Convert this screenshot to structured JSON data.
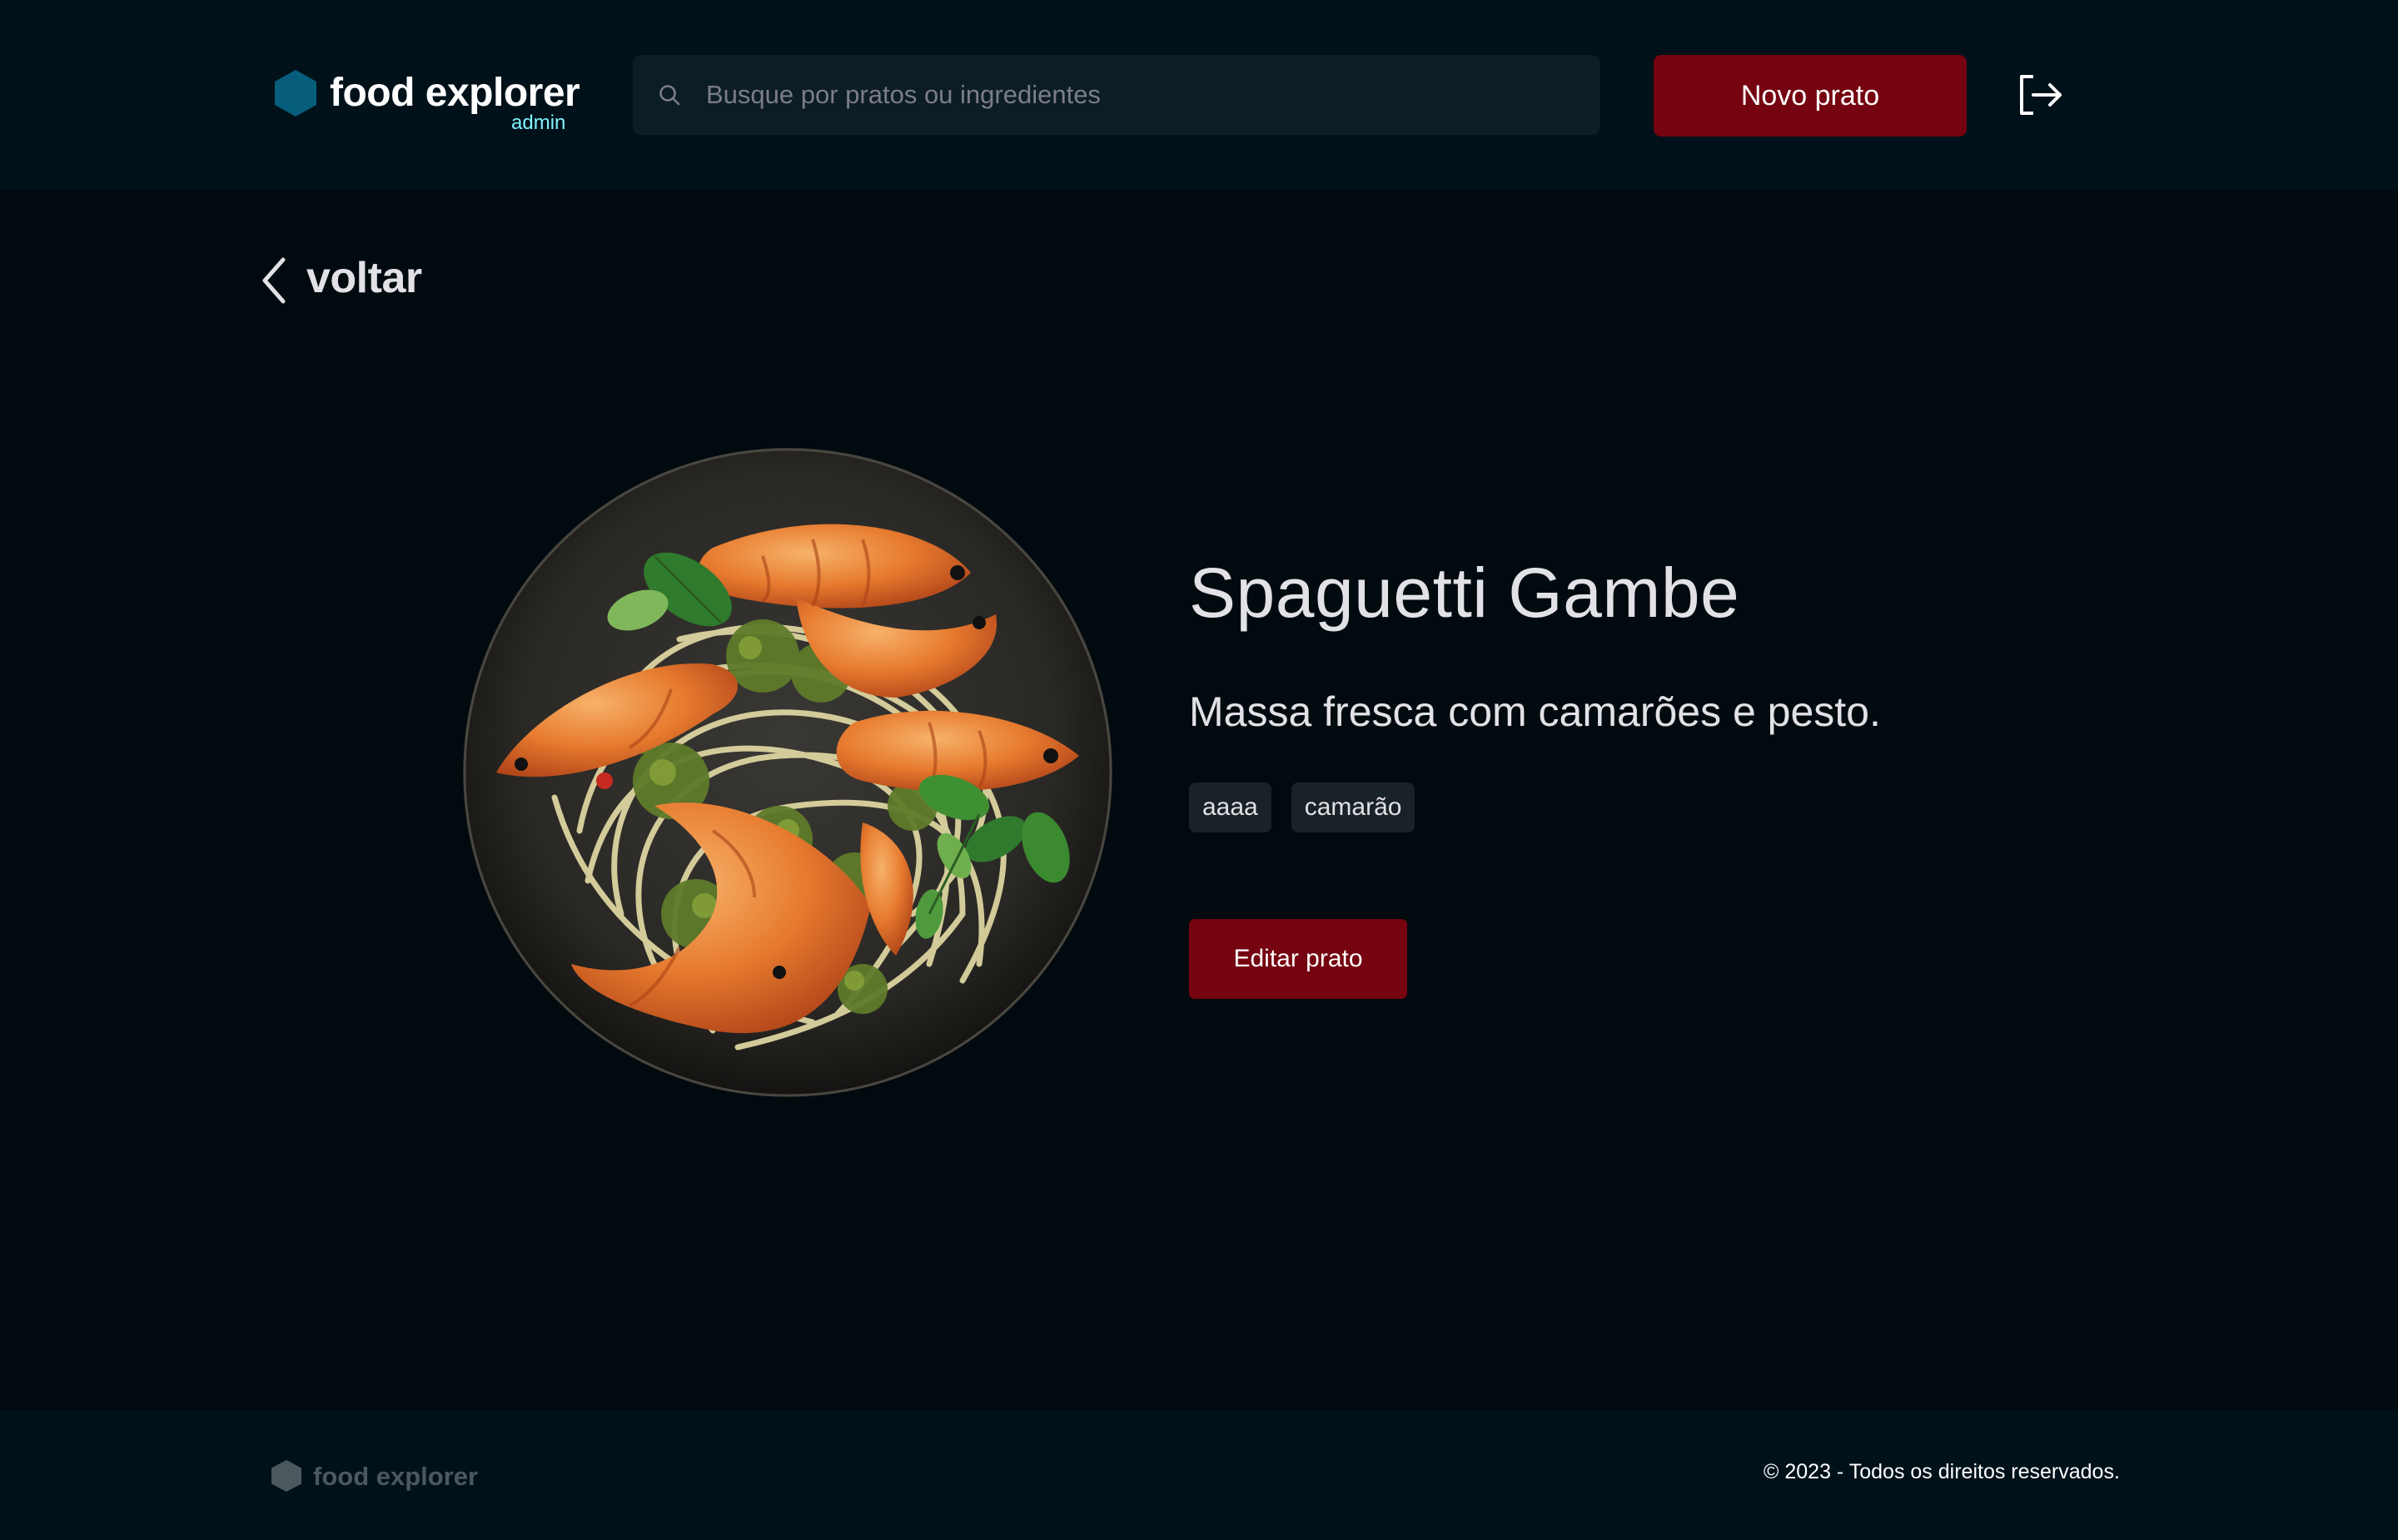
{
  "header": {
    "brand_name": "food explorer",
    "brand_badge": "admin",
    "brand_icon": "hexagon-logo-icon",
    "search": {
      "placeholder": "Busque por pratos ou ingredientes",
      "value": "",
      "icon": "search-icon"
    },
    "new_dish_label": "Novo prato",
    "logout_icon": "sign-out-icon"
  },
  "back": {
    "label": "voltar",
    "icon": "chevron-left-icon"
  },
  "dish": {
    "title": "Spaguetti Gambe",
    "description": "Massa fresca com camarões e pesto.",
    "ingredients": [
      "aaaa",
      "camarão"
    ],
    "edit_label": "Editar prato"
  },
  "footer": {
    "brand_name": "food explorer",
    "copyright": "© 2023 - Todos os direitos reservados."
  },
  "colors": {
    "background": "#000a0f",
    "header_bg": "#00111a",
    "accent_red": "#750310",
    "brand_blue": "#065e7c",
    "admin_cyan": "#82f3ff",
    "tag_bg": "#192227"
  }
}
